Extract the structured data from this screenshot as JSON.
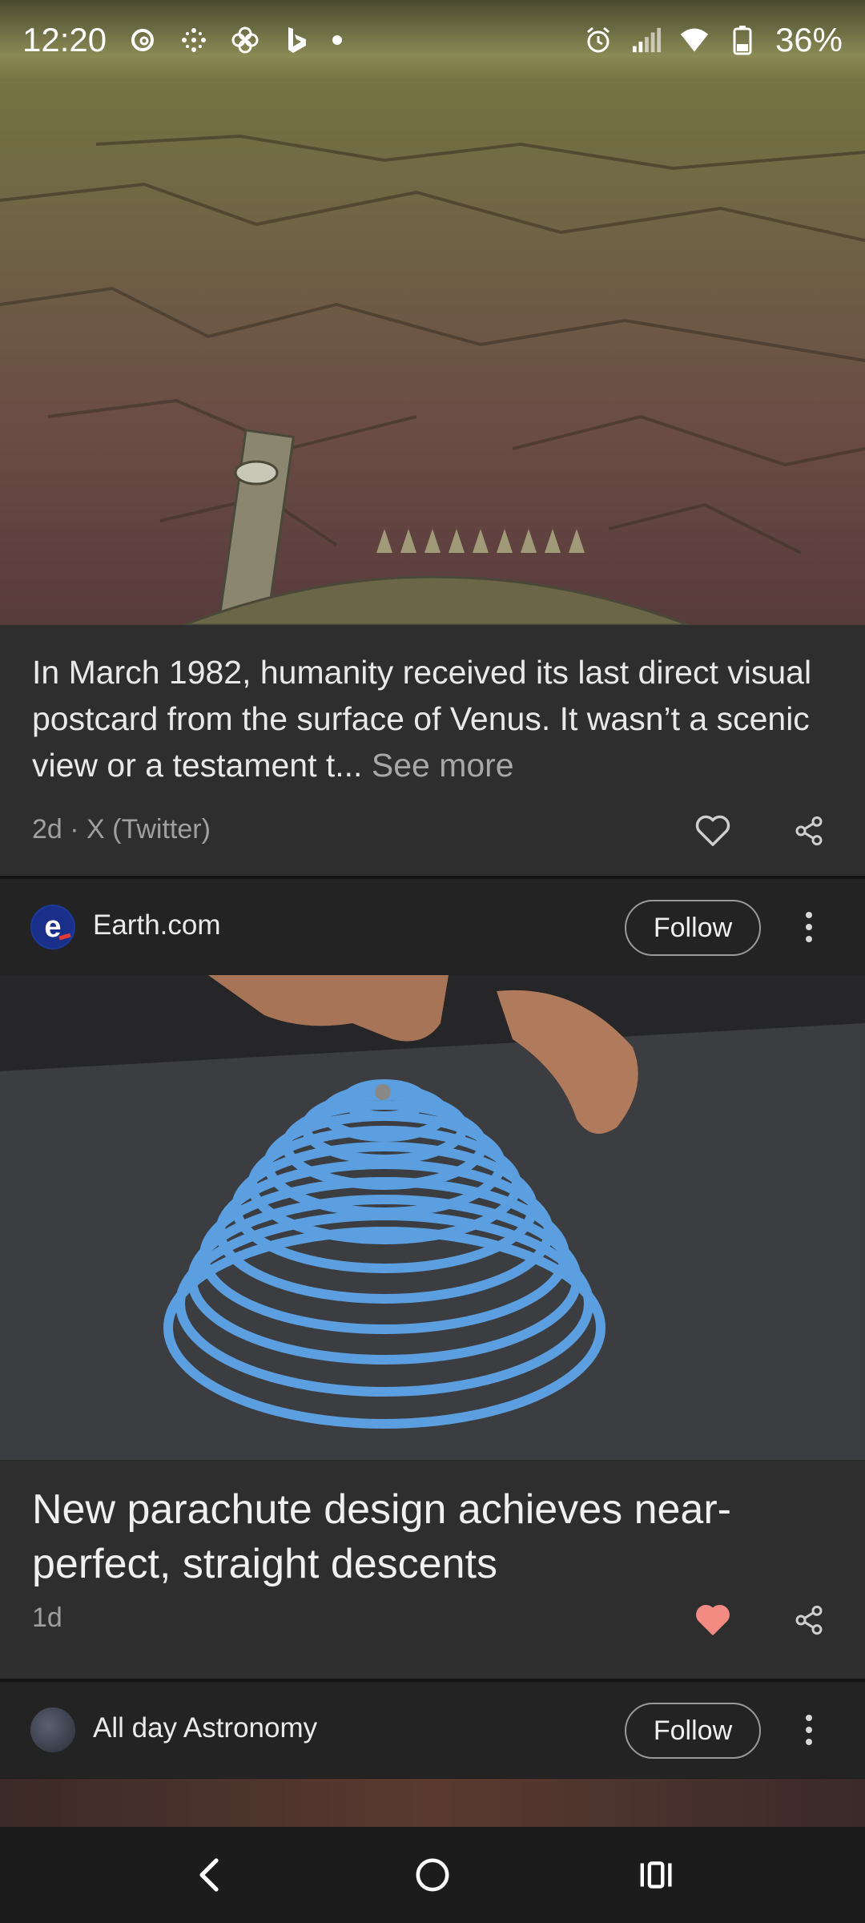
{
  "status_bar": {
    "time": "12:20",
    "left_icons": [
      "threads-icon",
      "grid-dots-icon",
      "pinwheel-icon",
      "bing-icon",
      "notification-dot-icon"
    ],
    "right_icons": [
      "alarm-icon",
      "signal-icon",
      "wifi-icon",
      "battery-icon"
    ],
    "battery": "36%"
  },
  "feed": {
    "card1": {
      "image_alt": "Venus surface photo",
      "text": "In March 1982, humanity received its last direct visual postcard from the surface of Venus. It wasn’t a scenic view or a testament t...",
      "see_more": "See more",
      "meta": "2d · X (Twitter)",
      "liked": false
    },
    "source2": {
      "name": "Earth.com",
      "follow_label": "Follow",
      "logo_letter": "e"
    },
    "card2": {
      "image_alt": "blue paper parachute",
      "title": "New parachute design achieves near-perfect, straight descents",
      "meta": "1d",
      "liked": true
    },
    "source3": {
      "name": "All day Astronomy",
      "follow_label": "Follow"
    }
  },
  "colors": {
    "like_active": "#f28b82",
    "background": "#1f1f1f",
    "card": "#2e2e2f"
  },
  "nav": {
    "buttons": [
      "back-icon",
      "home-icon",
      "recents-icon"
    ]
  }
}
